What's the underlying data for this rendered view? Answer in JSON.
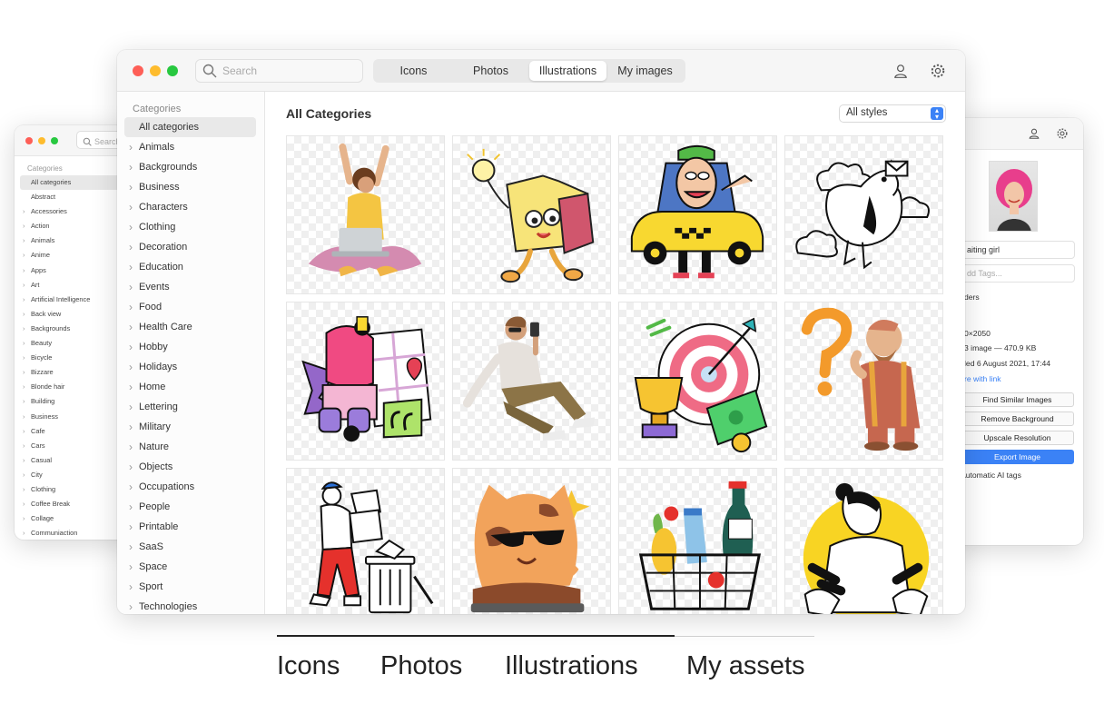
{
  "left_window": {
    "search_placeholder": "Search",
    "categories_heading": "Categories",
    "items": [
      "All categories",
      "Abstract",
      "Accessories",
      "Action",
      "Animals",
      "Anime",
      "Apps",
      "Art",
      "Artificial Intelligence",
      "Back view",
      "Backgrounds",
      "Beauty",
      "Bicycle",
      "Bizzare",
      "Blonde hair",
      "Building",
      "Business",
      "Cafe",
      "Cars",
      "Casual",
      "City",
      "Clothing",
      "Coffee Break",
      "Collage",
      "Communiaction"
    ]
  },
  "main_window": {
    "search_placeholder": "Search",
    "tabs": [
      "Icons",
      "Photos",
      "Illustrations",
      "My images"
    ],
    "active_tab": "Illustrations",
    "sidebar": {
      "heading": "Categories",
      "items": [
        "All categories",
        "Animals",
        "Backgrounds",
        "Business",
        "Characters",
        "Clothing",
        "Decoration",
        "Education",
        "Events",
        "Food",
        "Health Care",
        "Hobby",
        "Holidays",
        "Home",
        "Lettering",
        "Military",
        "Nature",
        "Objects",
        "Occupations",
        "People",
        "Printable",
        "SaaS",
        "Space",
        "Sport",
        "Technologies"
      ]
    },
    "content": {
      "title": "All Categories",
      "style_filter": "All styles",
      "tiles": [
        "yoga-laptop-illustration",
        "happy-folder-illustration",
        "taxi-driver-illustration",
        "pigeon-mail-illustration",
        "scooter-map-illustration",
        "sitting-man-phone-illustration",
        "target-trophy-illustration",
        "thinking-man-question-illustration",
        "man-trash-boxes-illustration",
        "cool-cat-illustration",
        "grocery-basket-illustration",
        "woman-interview-illustration"
      ]
    }
  },
  "right_window": {
    "name_value": "aiting girl",
    "tags_placeholder": "dd Tags...",
    "line1": "ders",
    "line2": "0×2050",
    "line3": "3 image — 470.9 KB",
    "line4": "led 6 August 2021, 17:44",
    "share_link": "re with link",
    "buttons": [
      "Find Similar Images",
      "Remove Background",
      "Upscale Resolution",
      "Export Image"
    ],
    "auto_tags": "Automatic AI tags"
  },
  "bottom_tabs": [
    "Icons",
    "Photos",
    "Illustrations",
    "My assets"
  ],
  "colors": {
    "accent": "#3b82f6",
    "close": "#fe5f57",
    "minimize": "#febc2e",
    "zoom": "#28c840"
  }
}
